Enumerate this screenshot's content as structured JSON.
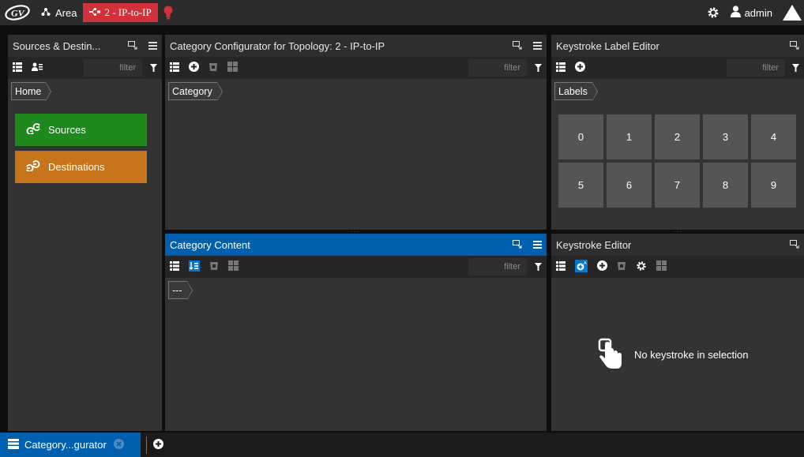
{
  "topbar": {
    "area_label": "Area",
    "topology_label": "2 - IP-to-IP",
    "user_label": "admin"
  },
  "sources_panel": {
    "title": "Sources & Destin...",
    "filter_placeholder": "filter",
    "breadcrumb": "Home",
    "items": [
      {
        "label": "Sources",
        "color": "#1e8a1e"
      },
      {
        "label": "Destinations",
        "color": "#c7741a"
      }
    ]
  },
  "category_configurator": {
    "title": "Category Configurator for Topology: 2 - IP-to-IP",
    "filter_placeholder": "filter",
    "breadcrumb": "Category"
  },
  "label_editor": {
    "title": "Keystroke Label Editor",
    "filter_placeholder": "filter",
    "breadcrumb": "Labels",
    "keys": [
      "0",
      "1",
      "2",
      "3",
      "4",
      "5",
      "6",
      "7",
      "8",
      "9"
    ]
  },
  "category_content": {
    "title": "Category Content",
    "filter_placeholder": "filter",
    "breadcrumb": "---"
  },
  "keystroke_editor": {
    "title": "Keystroke Editor",
    "empty_message": "No keystroke in selection"
  },
  "bottombar": {
    "tab_label": "Category...gurator"
  },
  "colors": {
    "accent_blue": "#0060b0",
    "topology_red": "#d0313b"
  }
}
